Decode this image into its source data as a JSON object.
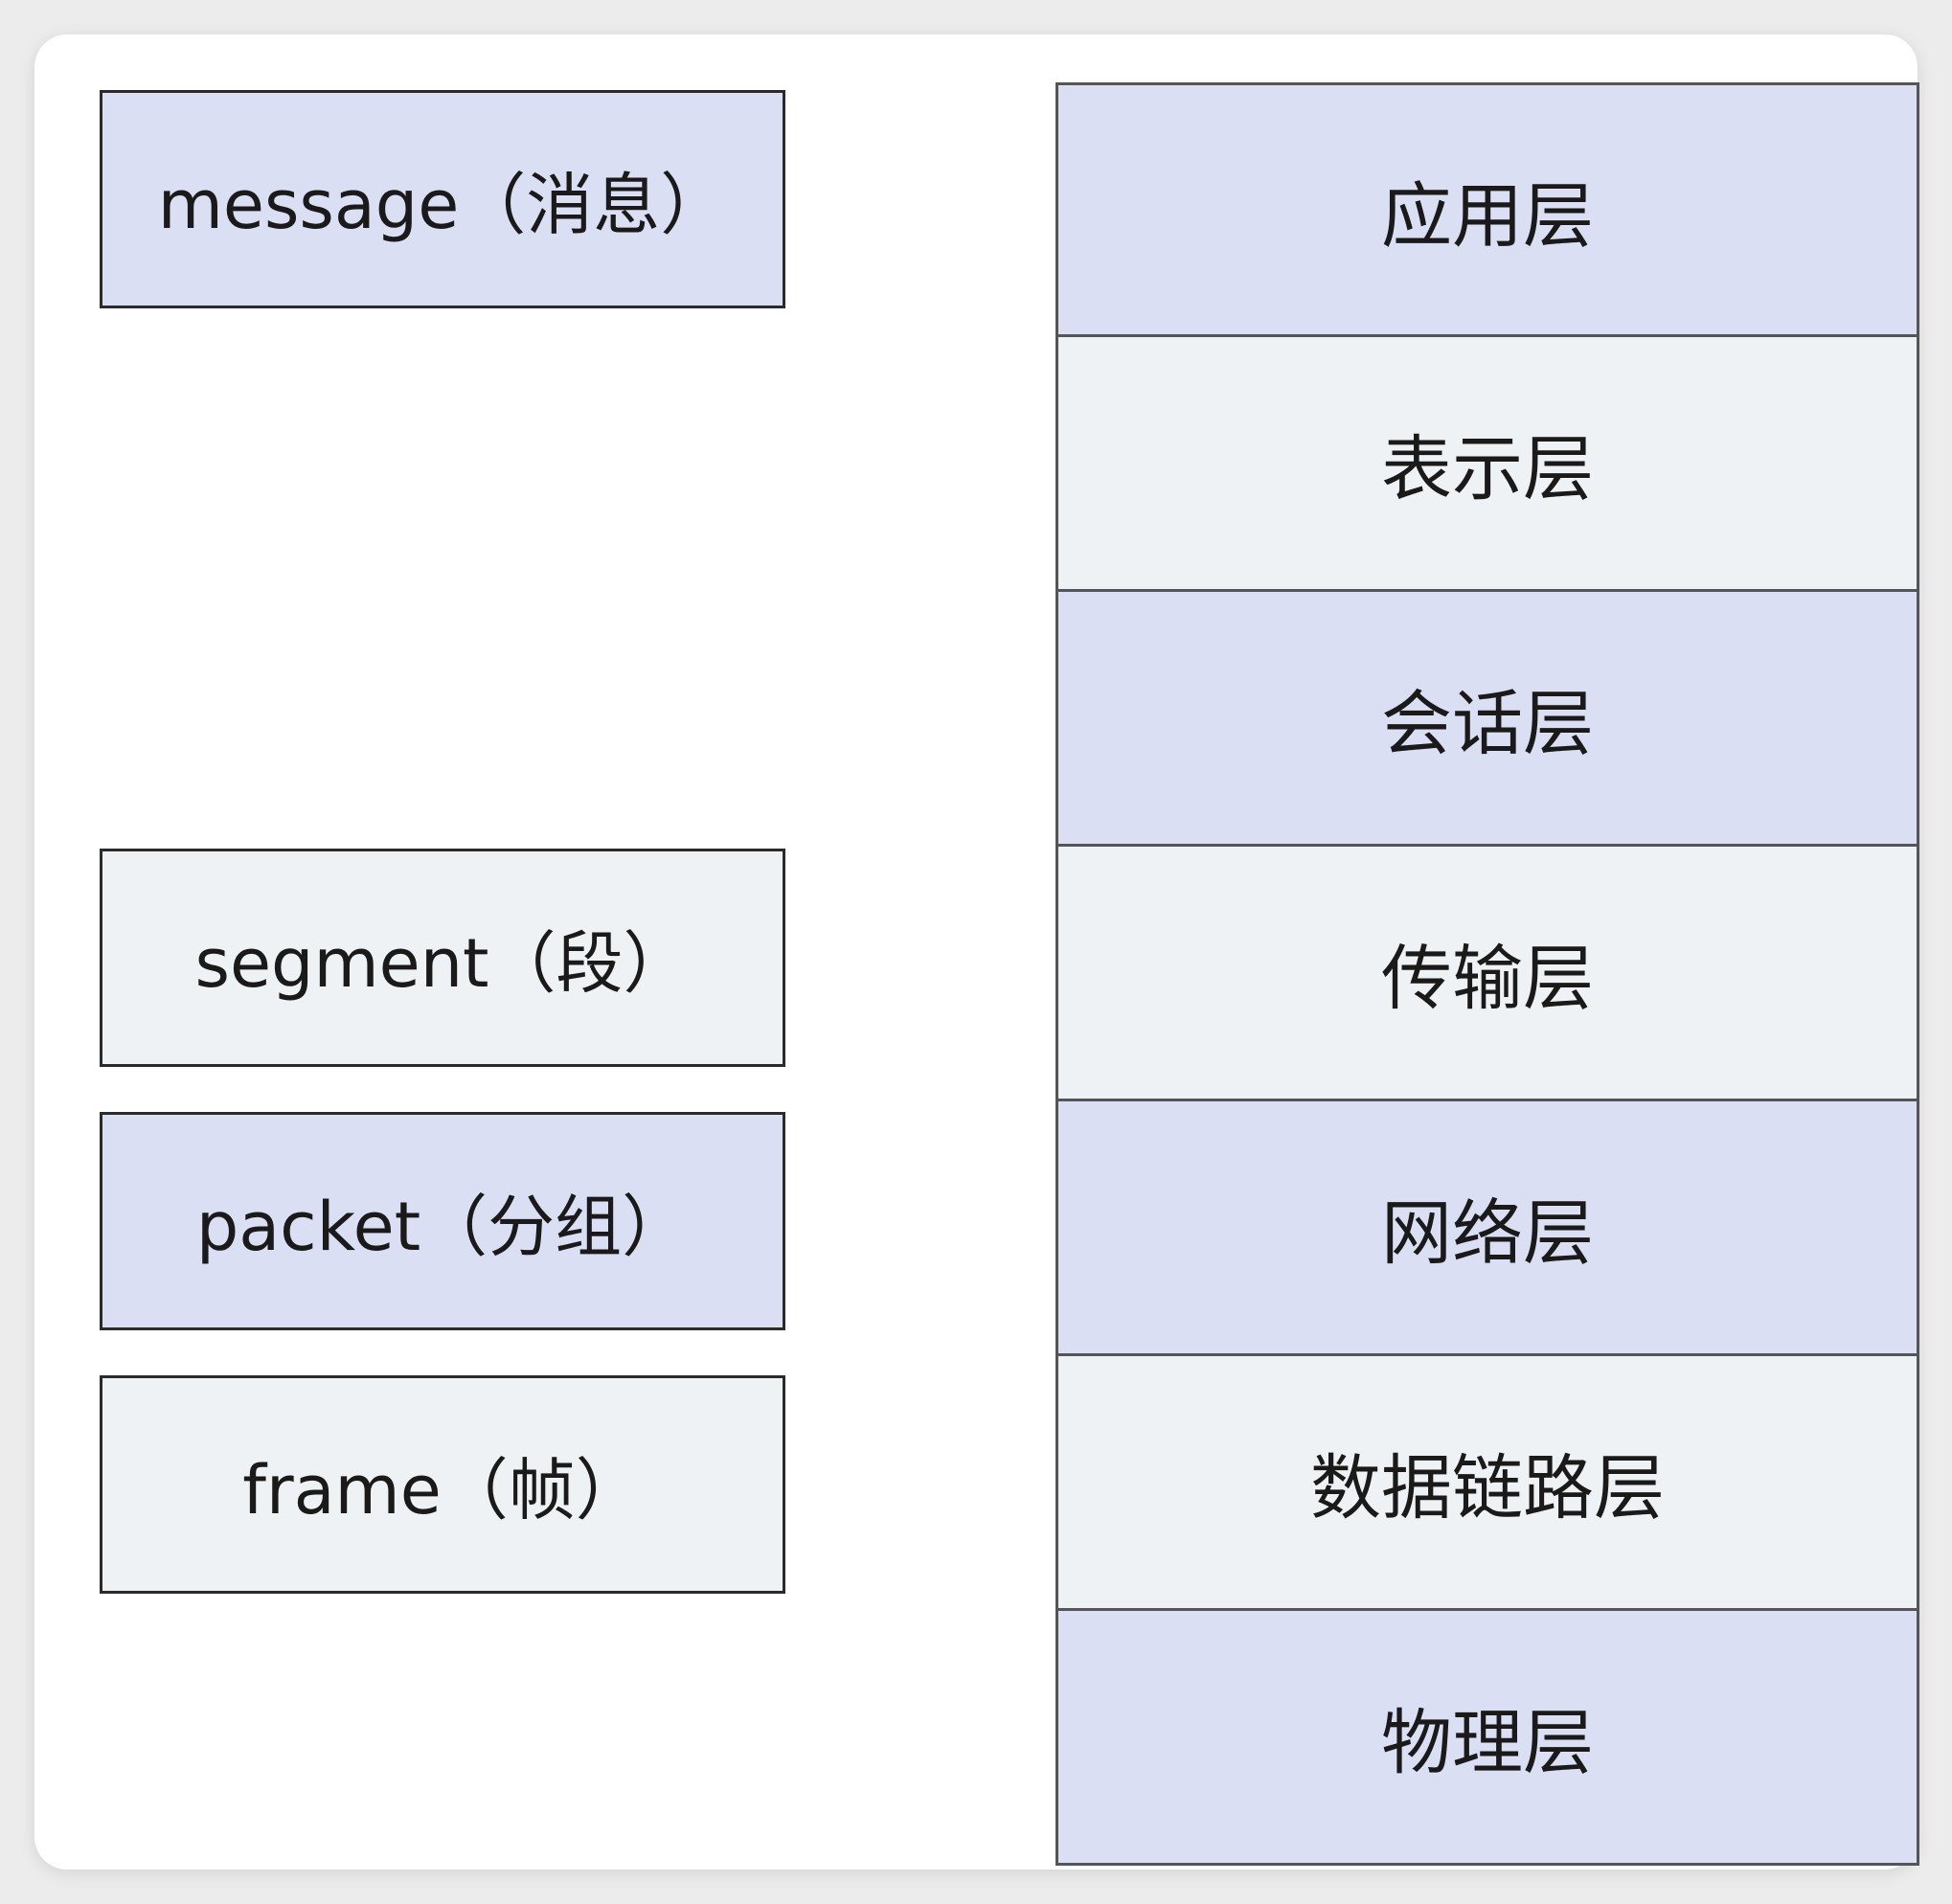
{
  "colors": {
    "tinted": "#dadff3",
    "plain": "#eff2f4",
    "border": "#2b2b2b"
  },
  "pdu_units": [
    {
      "label": "message（消息）",
      "style": "tinted"
    },
    {
      "label": "segment（段）",
      "style": "plain"
    },
    {
      "label": "packet（分组）",
      "style": "tinted"
    },
    {
      "label": "frame（帧）",
      "style": "plain"
    }
  ],
  "osi_layers": [
    {
      "label": "应用层",
      "style": "tinted"
    },
    {
      "label": "表示层",
      "style": "plain"
    },
    {
      "label": "会话层",
      "style": "tinted"
    },
    {
      "label": "传输层",
      "style": "plain"
    },
    {
      "label": "网络层",
      "style": "tinted"
    },
    {
      "label": "数据链路层",
      "style": "plain"
    },
    {
      "label": "物理层",
      "style": "tinted"
    }
  ]
}
